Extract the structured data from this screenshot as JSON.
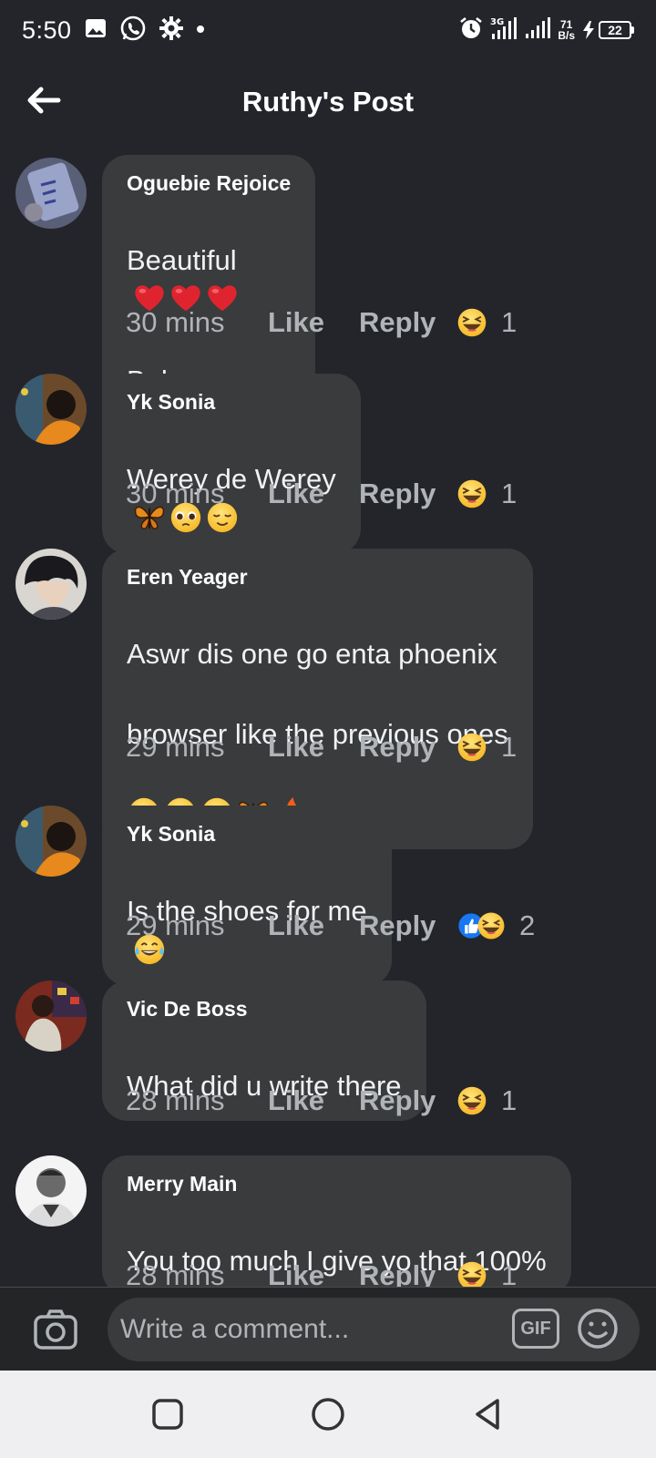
{
  "status_bar": {
    "time": "5:50",
    "network_speed_value": "71",
    "network_speed_unit": "B/s",
    "battery_level": "22"
  },
  "header": {
    "title": "Ruthy's Post"
  },
  "comments": [
    {
      "author": "Oguebie Rejoice",
      "text_line1": "Beautiful",
      "text_line2": "Buh crazy",
      "time": "30 mins",
      "like_label": "Like",
      "reply_label": "Reply",
      "reaction_count": "1"
    },
    {
      "author": "Yk Sonia",
      "text": "Werey de Werey",
      "time": "30 mins",
      "like_label": "Like",
      "reply_label": "Reply",
      "reaction_count": "1"
    },
    {
      "author": "Eren Yeager",
      "text_line1": "Aswr dis one go enta phoenix",
      "text_line2": "browser like the previous ones",
      "time": "29 mins",
      "like_label": "Like",
      "reply_label": "Reply",
      "reaction_count": "1"
    },
    {
      "author": "Yk Sonia",
      "text": "Is the shoes for me",
      "time": "29 mins",
      "like_label": "Like",
      "reply_label": "Reply",
      "reaction_count": "2"
    },
    {
      "author": "Vic De Boss",
      "text": "What did u write there",
      "time": "28 mins",
      "like_label": "Like",
      "reply_label": "Reply",
      "reaction_count": "1"
    },
    {
      "author": "Merry Main",
      "text": "You too much I give yo that 100%",
      "time": "28 mins",
      "like_label": "Like",
      "reply_label": "Reply",
      "reaction_count": "1"
    }
  ],
  "composer": {
    "placeholder": "Write a comment...",
    "gif_label": "GIF"
  },
  "colors": {
    "background": "#23252b",
    "bubble": "#3a3b3c",
    "secondary_text": "#b0b3b8",
    "like_blue": "#1877f2",
    "haha_yellow": "#f7b928",
    "heart_red": "#e0242f"
  }
}
